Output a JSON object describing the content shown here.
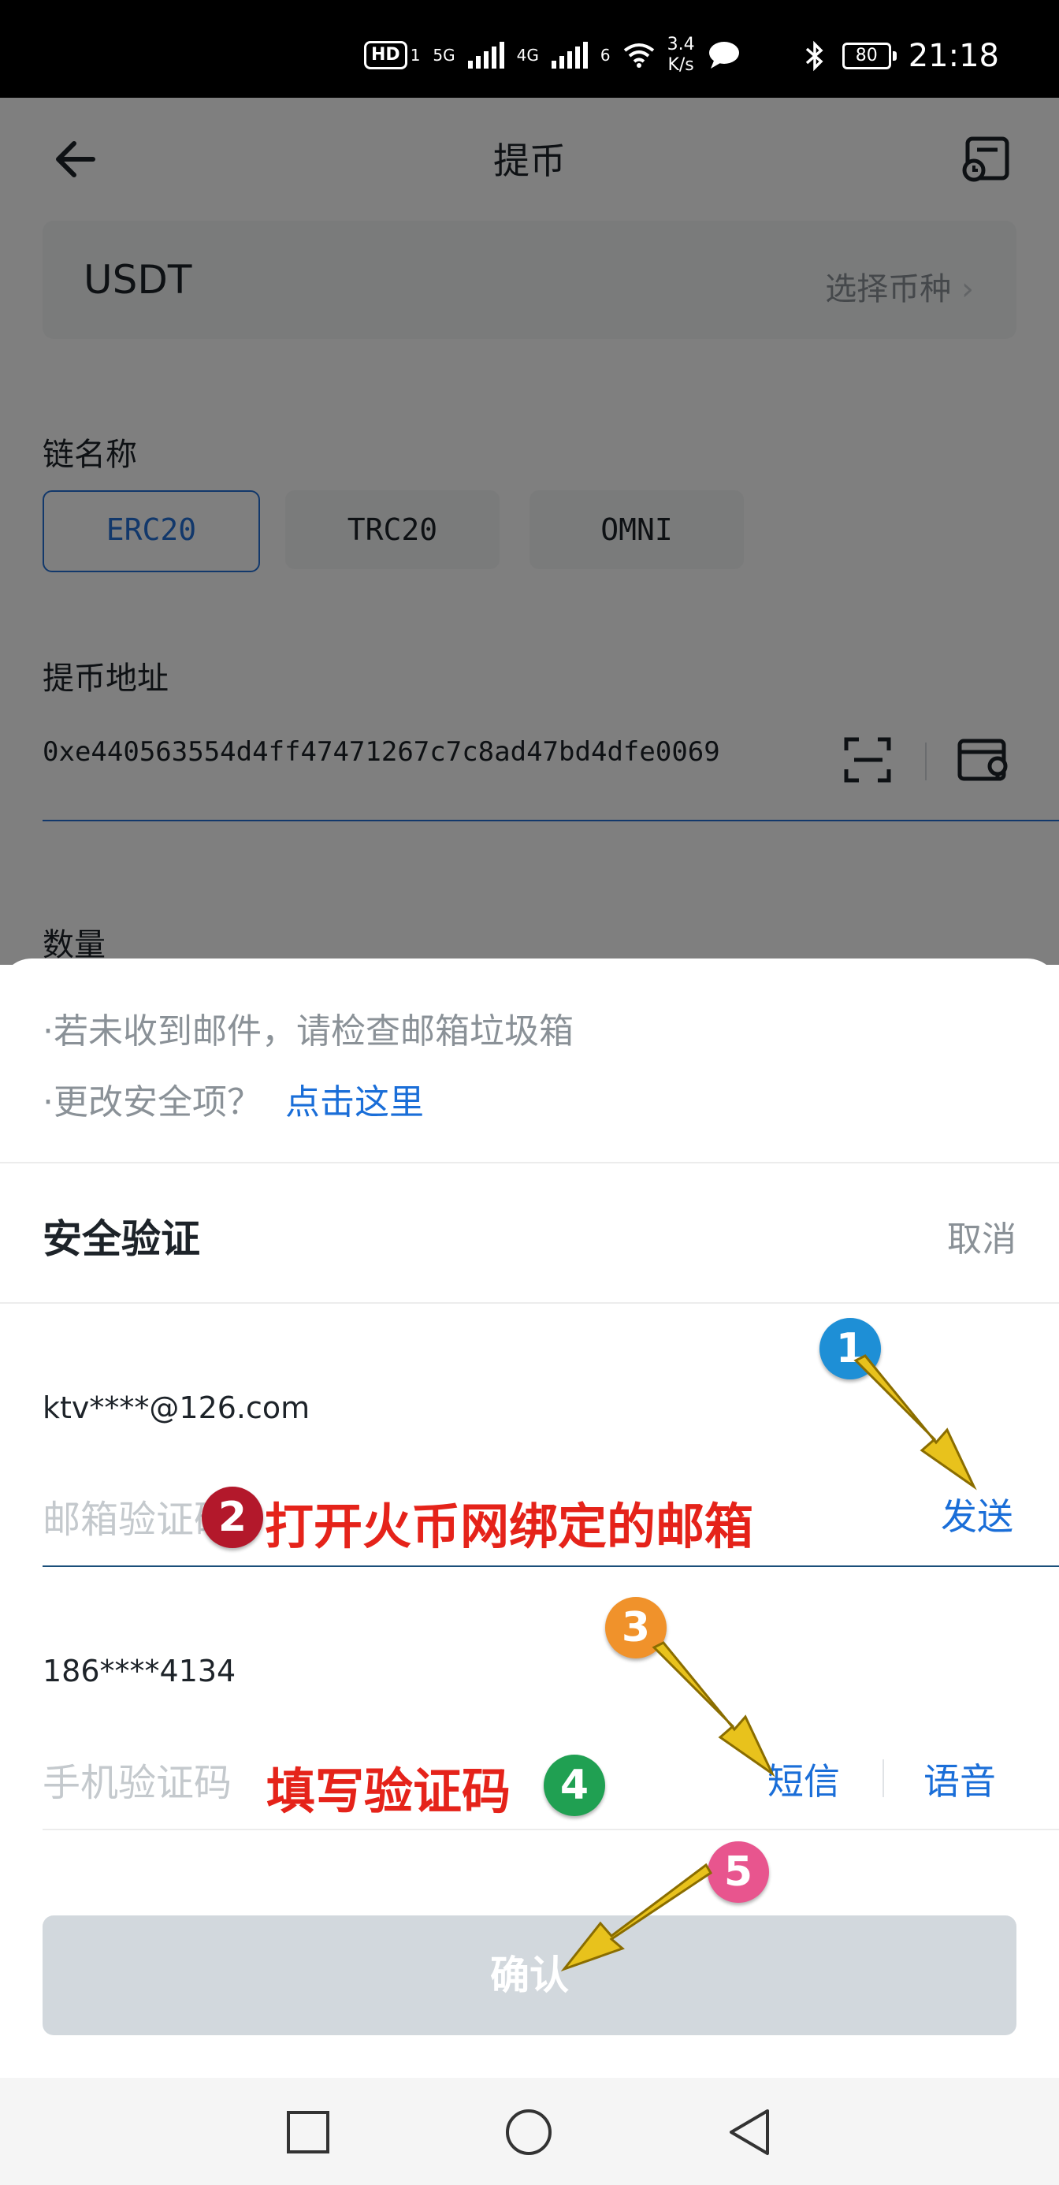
{
  "status_bar": {
    "network_badge": "HD",
    "sim": "1",
    "net1": "5G",
    "net2": "4G",
    "net3": "6",
    "speed_value": "3.4",
    "speed_unit": "K/s",
    "battery": "80",
    "time": "21:18"
  },
  "header": {
    "title": "提币"
  },
  "coin": {
    "name": "USDT",
    "select_label": "选择币种"
  },
  "chain": {
    "label": "链名称",
    "options": [
      "ERC20",
      "TRC20",
      "OMNI"
    ],
    "selected": "ERC20"
  },
  "address": {
    "label": "提币地址",
    "value": "0xe440563554d4ff47471267c7c8ad47bd4dfe0069"
  },
  "amount": {
    "label": "数量"
  },
  "sheet": {
    "tip1": "·若未收到邮件，请检查邮箱垃圾箱",
    "tip2": "·更改安全项？",
    "tip2_link": "点击这里",
    "title": "安全验证",
    "cancel": "取消",
    "email": {
      "account": "ktv****@126.com",
      "placeholder": "邮箱验证码",
      "send": "发送"
    },
    "phone": {
      "account": "186****4134",
      "placeholder": "手机验证码",
      "sms": "短信",
      "voice": "语音"
    },
    "confirm": "确认"
  },
  "annotations": {
    "step1": "1",
    "step2": "2",
    "step2_text": "打开火币网绑定的邮箱",
    "step3": "3",
    "step4": "4",
    "step4_text": "填写验证码",
    "step5": "5",
    "colors": {
      "step1": "#1e8fd6",
      "step2": "#b3182b",
      "step3": "#f0922b",
      "step4": "#20a052",
      "step5": "#e8558e",
      "arrow": "#e8c21c"
    }
  }
}
